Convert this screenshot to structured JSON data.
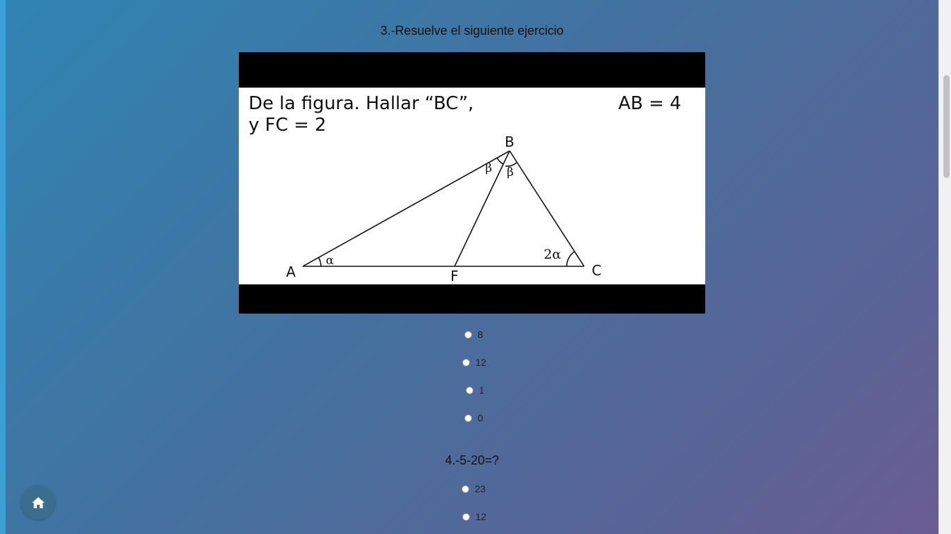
{
  "questions": [
    {
      "title": "3.-Resuelve el siguiente ejercicio",
      "figure": {
        "statement_line1": "De la figura. Hallar “BC”,",
        "statement_right": "AB = 4",
        "statement_line2": "y FC = 2",
        "labels": {
          "a": "A",
          "b": "B",
          "c": "C",
          "f": "F",
          "alpha": "α",
          "two_alpha": "2α",
          "beta": "β"
        }
      },
      "options": [
        "8",
        "12",
        "1",
        "0"
      ]
    },
    {
      "title": "4.-5-20=?",
      "options": [
        "23",
        "12"
      ]
    }
  ],
  "home_button": {
    "icon": "home-icon"
  },
  "colors": {
    "accent": "#3aa0d6",
    "home_bg": "#3b6d8f"
  }
}
